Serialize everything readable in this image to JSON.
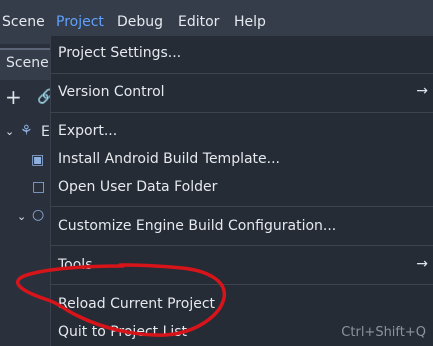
{
  "menubar": {
    "scene": "Scene",
    "project": "Project",
    "debug": "Debug",
    "editor": "Editor",
    "help": "Help"
  },
  "scene_panel": {
    "tab_label": "Scene",
    "node_prefix": "E"
  },
  "project_menu": {
    "project_settings": "Project Settings...",
    "version_control": "Version Control",
    "export": "Export...",
    "install_android_build_template": "Install Android Build Template...",
    "open_user_data_folder": "Open User Data Folder",
    "customize_engine_build_configuration": "Customize Engine Build Configuration...",
    "tools": "Tools",
    "reload_current_project": "Reload Current Project",
    "quit_to_project_list": "Quit to Project List",
    "quit_shortcut": "Ctrl+Shift+Q"
  },
  "colors": {
    "menubar_bg": "#363d4a",
    "dropdown_bg": "#262c35",
    "active_menu": "#5ea1ff",
    "annotation": "#d8141b"
  }
}
